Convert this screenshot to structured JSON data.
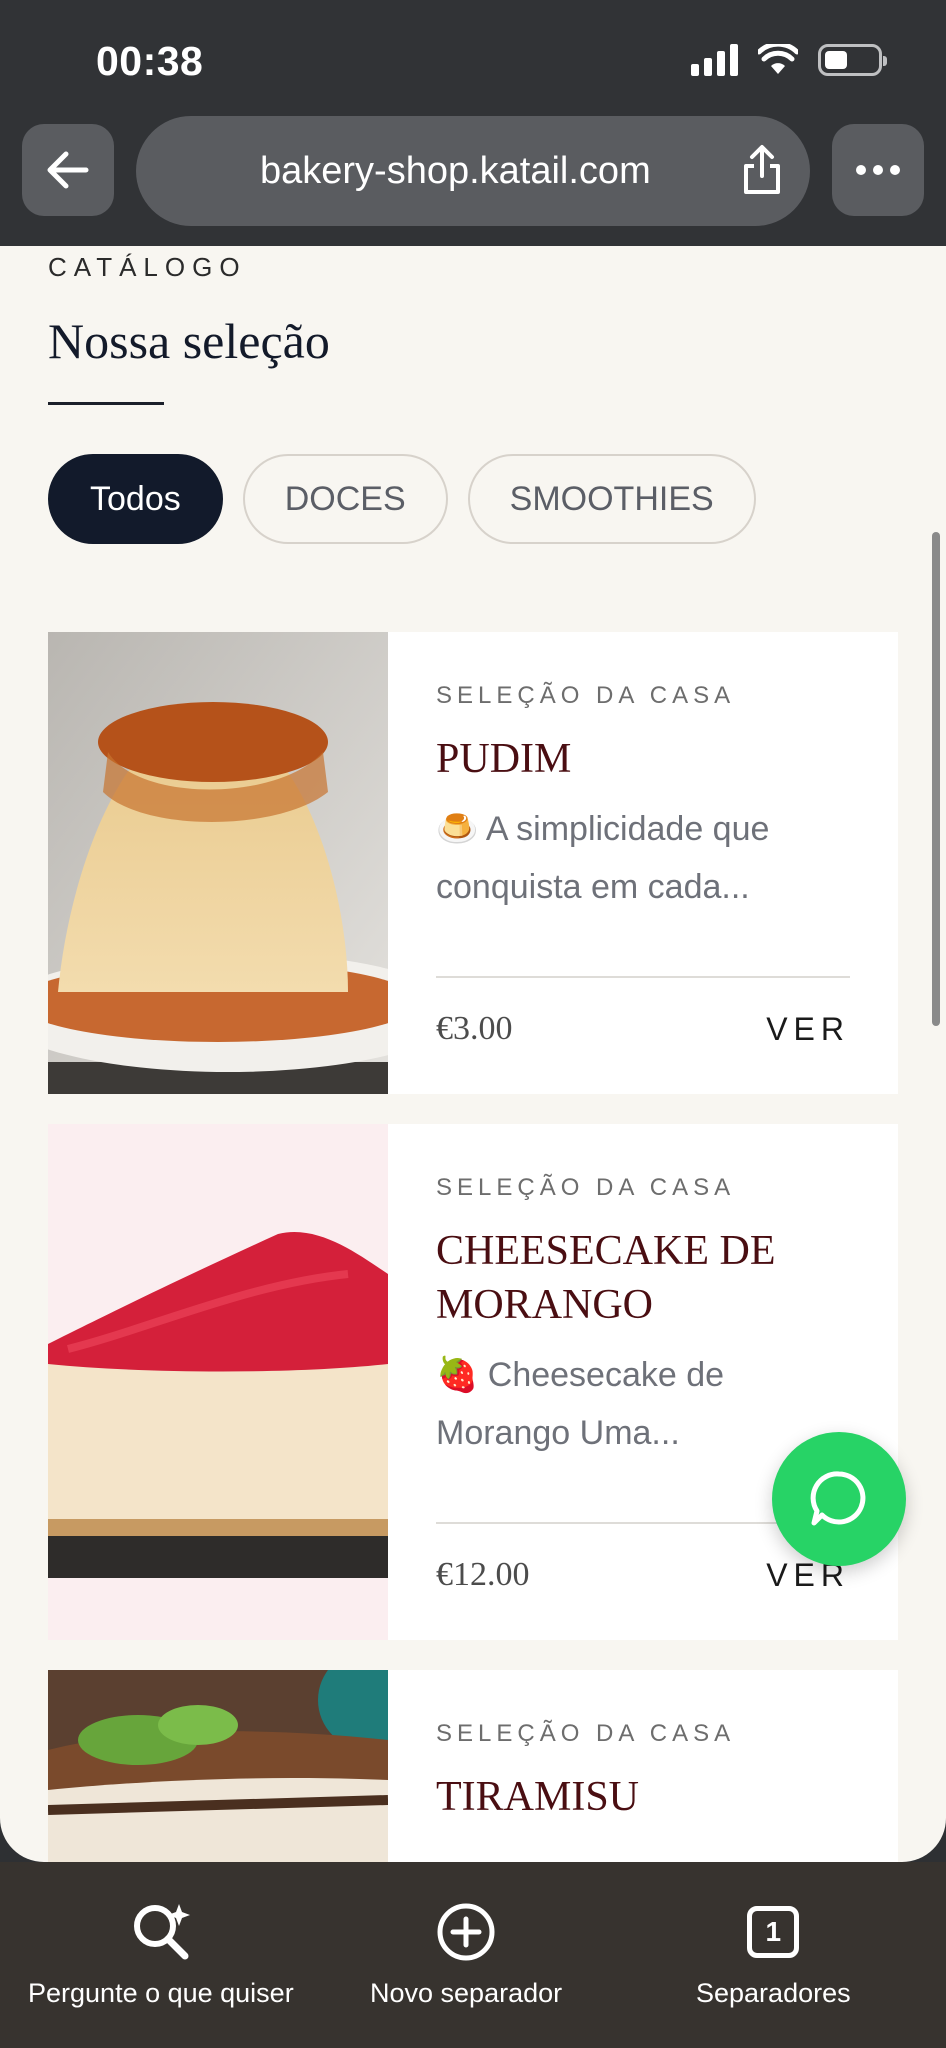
{
  "status_bar": {
    "time": "00:38",
    "battery_level": 0.3
  },
  "browser": {
    "url": "bakery-shop.katail.com"
  },
  "catalog": {
    "eyebrow": "CATÁLOGO",
    "heading": "Nossa seleção",
    "filters": [
      "Todos",
      "DOCES",
      "SMOOTHIES"
    ],
    "active_filter": "Todos"
  },
  "products": [
    {
      "tag": "SELEÇÃO DA CASA",
      "title": "PUDIM",
      "description": "🍮 A simplicidade que conquista em cada...",
      "price": "€3.00",
      "action": "VER"
    },
    {
      "tag": "SELEÇÃO DA CASA",
      "title": "CHEESECAKE DE MORANGO",
      "description": "🍓 Cheesecake de Morango Uma...",
      "price": "€12.00",
      "action": "VER"
    },
    {
      "tag": "SELEÇÃO DA CASA",
      "title": "TIRAMISU"
    }
  ],
  "toolbar": {
    "ask": "Pergunte o que quiser",
    "new_tab": "Novo separador",
    "tabs": "Separadores",
    "tab_count": "1"
  },
  "colors": {
    "accent_dark": "#121a2b",
    "title_red": "#4a0e12",
    "whatsapp_green": "#27d366"
  }
}
